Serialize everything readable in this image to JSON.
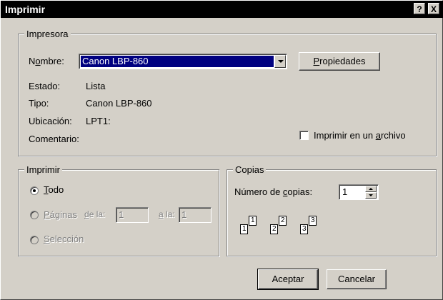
{
  "window": {
    "title": "Imprimir",
    "help_button": "?",
    "close_button": "X"
  },
  "printer": {
    "group_label": "Impresora",
    "name_label_pre": "N",
    "name_label_acc": "o",
    "name_label_post": "mbre:",
    "name_value": "Canon LBP-860",
    "properties_acc": "P",
    "properties_post": "ropiedades",
    "status_label": "Estado:",
    "status_value": "Lista",
    "type_label": "Tipo:",
    "type_value": "Canon LBP-860",
    "location_label": "Ubicación:",
    "location_value": "LPT1:",
    "comment_label": "Comentario:",
    "print_to_file_pre": "Imprimir en un ",
    "print_to_file_acc": "a",
    "print_to_file_post": "rchivo",
    "print_to_file_checked": false
  },
  "range": {
    "group_label": "Imprimir",
    "all_acc": "T",
    "all_post": "odo",
    "pages_acc": "P",
    "pages_post": "áginas",
    "from_pre": "",
    "from_acc": "d",
    "from_post": "e la:",
    "from_value": "1",
    "to_pre": "",
    "to_acc": "a",
    "to_post": " la:",
    "to_value": "1",
    "selection_acc": "S",
    "selection_post": "elección",
    "selected": "all"
  },
  "copies": {
    "group_label": "Copias",
    "count_label_pre": "Número de ",
    "count_label_acc": "c",
    "count_label_post": "opias:",
    "count_value": "1",
    "collate_pages": [
      "1",
      "1",
      "2",
      "2",
      "3",
      "3"
    ]
  },
  "buttons": {
    "ok": "Aceptar",
    "cancel": "Cancelar"
  }
}
